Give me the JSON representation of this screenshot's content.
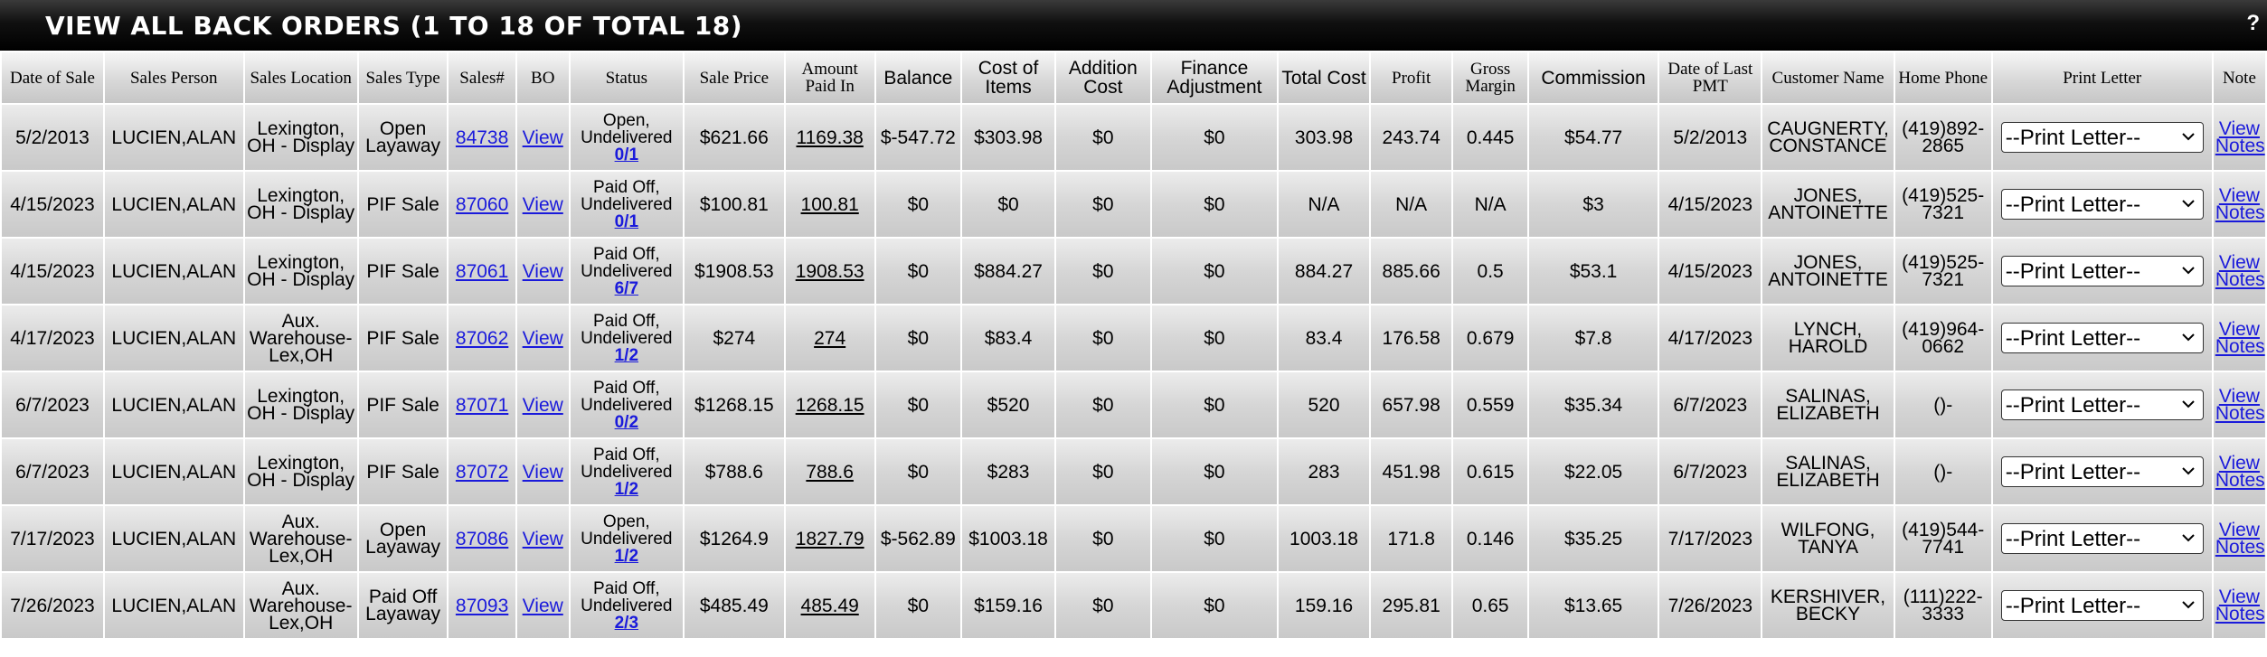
{
  "page": {
    "title": "VIEW ALL BACK ORDERS",
    "count_text": "(1 TO 18 OF TOTAL 18)",
    "help": "?"
  },
  "headers": [
    "Date of Sale",
    "Sales Person",
    "Sales Location",
    "Sales Type",
    "Sales#",
    "BO",
    "Status",
    "Sale Price",
    "Amount Paid In",
    "Balance",
    "Cost of Items",
    "Addition Cost",
    "Finance Adjustment",
    "Total Cost",
    "Profit",
    "Gross Margin",
    "Commission",
    "Date of Last PMT",
    "Customer Name",
    "Home Phone",
    "Print Letter",
    "Note"
  ],
  "rows": [
    {
      "date": "5/2/2013",
      "person": "LUCIEN,ALAN",
      "location": "Lexington, OH - Display",
      "type": "Open Layaway",
      "sales_no": "84738",
      "bo": "View",
      "status": "Open, Undelivered",
      "status_link": "0/1",
      "price": "$621.66",
      "paid": "1169.38",
      "balance": "$-547.72",
      "cost_items": "$303.98",
      "add_cost": "$0",
      "fin_adj": "$0",
      "total_cost": "303.98",
      "profit": "243.74",
      "margin": "0.445",
      "commission": "$54.77",
      "last_pmt": "5/2/2013",
      "customer": "CAUGNERTY, CONSTANCE",
      "phone": "(419)892-2865",
      "print_letter": "--Print Letter--",
      "note": "View Notes"
    },
    {
      "date": "4/15/2023",
      "person": "LUCIEN,ALAN",
      "location": "Lexington, OH - Display",
      "type": "PIF Sale",
      "sales_no": "87060",
      "bo": "View",
      "status": "Paid Off, Undelivered",
      "status_link": "0/1",
      "price": "$100.81",
      "paid": "100.81",
      "balance": "$0",
      "cost_items": "$0",
      "add_cost": "$0",
      "fin_adj": "$0",
      "total_cost": "N/A",
      "profit": "N/A",
      "margin": "N/A",
      "commission": "$3",
      "last_pmt": "4/15/2023",
      "customer": "JONES, ANTOINETTE",
      "phone": "(419)525-7321",
      "print_letter": "--Print Letter--",
      "note": "View Notes"
    },
    {
      "date": "4/15/2023",
      "person": "LUCIEN,ALAN",
      "location": "Lexington, OH - Display",
      "type": "PIF Sale",
      "sales_no": "87061",
      "bo": "View",
      "status": "Paid Off, Undelivered",
      "status_link": "6/7",
      "price": "$1908.53",
      "paid": "1908.53",
      "balance": "$0",
      "cost_items": "$884.27",
      "add_cost": "$0",
      "fin_adj": "$0",
      "total_cost": "884.27",
      "profit": "885.66",
      "margin": "0.5",
      "commission": "$53.1",
      "last_pmt": "4/15/2023",
      "customer": "JONES, ANTOINETTE",
      "phone": "(419)525-7321",
      "print_letter": "--Print Letter--",
      "note": "View Notes"
    },
    {
      "date": "4/17/2023",
      "person": "LUCIEN,ALAN",
      "location": "Aux. Warehouse-Lex,OH",
      "type": "PIF Sale",
      "sales_no": "87062",
      "bo": "View",
      "status": "Paid Off, Undelivered",
      "status_link": "1/2",
      "price": "$274",
      "paid": "274",
      "balance": "$0",
      "cost_items": "$83.4",
      "add_cost": "$0",
      "fin_adj": "$0",
      "total_cost": "83.4",
      "profit": "176.58",
      "margin": "0.679",
      "commission": "$7.8",
      "last_pmt": "4/17/2023",
      "customer": "LYNCH, HAROLD",
      "phone": "(419)964-0662",
      "print_letter": "--Print Letter--",
      "note": "View Notes"
    },
    {
      "date": "6/7/2023",
      "person": "LUCIEN,ALAN",
      "location": "Lexington, OH - Display",
      "type": "PIF Sale",
      "sales_no": "87071",
      "bo": "View",
      "status": "Paid Off, Undelivered",
      "status_link": "0/2",
      "price": "$1268.15",
      "paid": "1268.15",
      "balance": "$0",
      "cost_items": "$520",
      "add_cost": "$0",
      "fin_adj": "$0",
      "total_cost": "520",
      "profit": "657.98",
      "margin": "0.559",
      "commission": "$35.34",
      "last_pmt": "6/7/2023",
      "customer": "SALINAS, ELIZABETH",
      "phone": "()-",
      "print_letter": "--Print Letter--",
      "note": "View Notes"
    },
    {
      "date": "6/7/2023",
      "person": "LUCIEN,ALAN",
      "location": "Lexington, OH - Display",
      "type": "PIF Sale",
      "sales_no": "87072",
      "bo": "View",
      "status": "Paid Off, Undelivered",
      "status_link": "1/2",
      "price": "$788.6",
      "paid": "788.6",
      "balance": "$0",
      "cost_items": "$283",
      "add_cost": "$0",
      "fin_adj": "$0",
      "total_cost": "283",
      "profit": "451.98",
      "margin": "0.615",
      "commission": "$22.05",
      "last_pmt": "6/7/2023",
      "customer": "SALINAS, ELIZABETH",
      "phone": "()-",
      "print_letter": "--Print Letter--",
      "note": "View Notes"
    },
    {
      "date": "7/17/2023",
      "person": "LUCIEN,ALAN",
      "location": "Aux. Warehouse-Lex,OH",
      "type": "Open Layaway",
      "sales_no": "87086",
      "bo": "View",
      "status": "Open, Undelivered",
      "status_link": "1/2",
      "price": "$1264.9",
      "paid": "1827.79",
      "balance": "$-562.89",
      "cost_items": "$1003.18",
      "add_cost": "$0",
      "fin_adj": "$0",
      "total_cost": "1003.18",
      "profit": "171.8",
      "margin": "0.146",
      "commission": "$35.25",
      "last_pmt": "7/17/2023",
      "customer": "WILFONG, TANYA",
      "phone": "(419)544-7741",
      "print_letter": "--Print Letter--",
      "note": "View Notes"
    },
    {
      "date": "7/26/2023",
      "person": "LUCIEN,ALAN",
      "location": "Aux. Warehouse-Lex,OH",
      "type": "Paid Off Layaway",
      "sales_no": "87093",
      "bo": "View",
      "status": "Paid Off, Undelivered",
      "status_link": "2/3",
      "price": "$485.49",
      "paid": "485.49",
      "balance": "$0",
      "cost_items": "$159.16",
      "add_cost": "$0",
      "fin_adj": "$0",
      "total_cost": "159.16",
      "profit": "295.81",
      "margin": "0.65",
      "commission": "$13.65",
      "last_pmt": "7/26/2023",
      "customer": "KERSHIVER, BECKY",
      "phone": "(111)222-3333",
      "print_letter": "--Print Letter--",
      "note": "View Notes"
    }
  ]
}
